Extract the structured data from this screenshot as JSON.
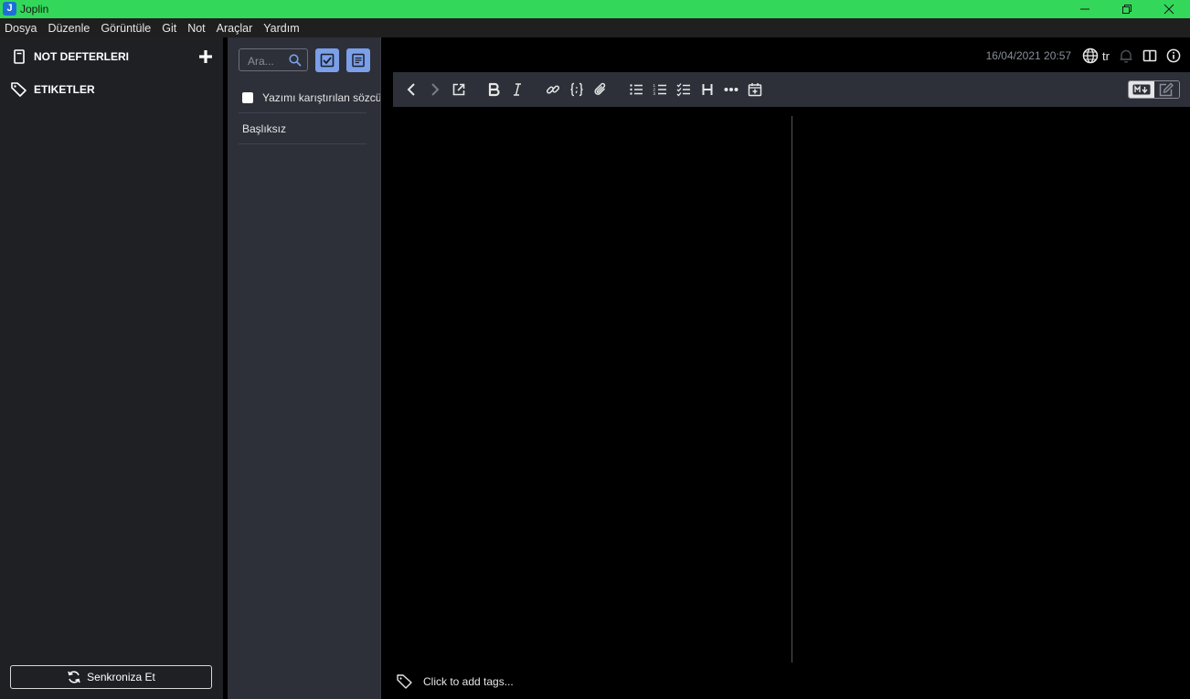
{
  "window": {
    "title": "Joplin",
    "app_icon_letter": "J",
    "titlebar_color": "#33d85a"
  },
  "menu": [
    "Dosya",
    "Düzenle",
    "Görüntüle",
    "Git",
    "Not",
    "Araçlar",
    "Yardım"
  ],
  "sidebar": {
    "notebooks_label": "NOT DEFTERLERI",
    "tags_label": "ETIKETLER",
    "sync_label": "Senkroniza Et"
  },
  "notelist": {
    "search_placeholder": "Ara...",
    "notes": [
      {
        "title": "Yazımı karıştırılan sözcü",
        "is_todo": true
      },
      {
        "title": "Başlıksız",
        "is_todo": false
      }
    ],
    "accent": "#7b9fe8"
  },
  "editor": {
    "datetime": "16/04/2021 20:57",
    "language": "tr",
    "tags_placeholder": "Click to add tags..."
  },
  "icons": [
    "notebook-icon",
    "tag-icon",
    "add-icon",
    "sync-icon",
    "search-icon",
    "toggle-todo-icon",
    "new-note-icon",
    "back-icon",
    "forward-icon",
    "external-edit-icon",
    "bold-icon",
    "italic-icon",
    "link-icon",
    "code-icon",
    "attach-icon",
    "bullet-list-icon",
    "numbered-list-icon",
    "checklist-icon",
    "heading-icon",
    "horizontal-rule-icon",
    "insert-date-icon",
    "globe-icon",
    "alarm-icon",
    "layout-icon",
    "info-icon",
    "markdown-icon",
    "edit-icon"
  ]
}
